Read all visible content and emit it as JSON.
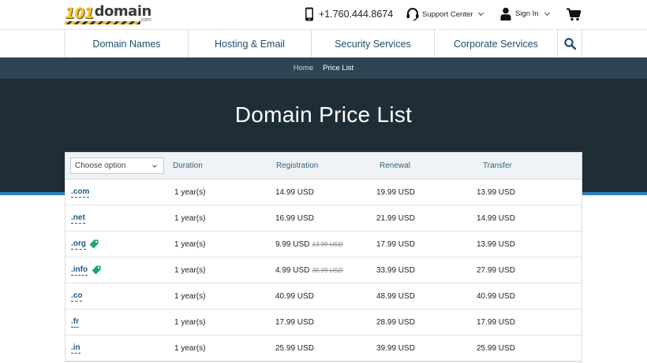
{
  "brand": {
    "logo_number": "101",
    "logo_word": "domain",
    "logo_suffix": ".com"
  },
  "header": {
    "phone": "+1.760.444.8674",
    "support_label": "Support Center",
    "signin_label": "Sign In"
  },
  "nav": {
    "items": [
      "Domain Names",
      "Hosting & Email",
      "Security Services",
      "Corporate Services"
    ]
  },
  "breadcrumb": {
    "home": "Home",
    "current": "Price List"
  },
  "page": {
    "title": "Domain Price List"
  },
  "colors": {
    "accent": "#2f86bf",
    "hero_bg": "#1f2e36",
    "link": "#1f5a82",
    "tag_green": "#1fa37a"
  },
  "table": {
    "filter_value": "Choose option",
    "columns": [
      "Duration",
      "Registration",
      "Renewal",
      "Transfer"
    ],
    "rows": [
      {
        "tld": ".com",
        "duration": "1 year(s)",
        "registration": "14.99 USD",
        "old_price": "",
        "renewal": "19.99 USD",
        "transfer": "13.99 USD",
        "sale": false
      },
      {
        "tld": ".net",
        "duration": "1 year(s)",
        "registration": "16.99 USD",
        "old_price": "",
        "renewal": "21.99 USD",
        "transfer": "14.99 USD",
        "sale": false
      },
      {
        "tld": ".org",
        "duration": "1 year(s)",
        "registration": "9.99 USD",
        "old_price": "13.99 USD",
        "renewal": "17.99 USD",
        "transfer": "13.99 USD",
        "sale": true
      },
      {
        "tld": ".info",
        "duration": "1 year(s)",
        "registration": "4.99 USD",
        "old_price": "30.99 USD",
        "renewal": "33.99 USD",
        "transfer": "27.99 USD",
        "sale": true
      },
      {
        "tld": ".co",
        "duration": "1 year(s)",
        "registration": "40.99 USD",
        "old_price": "",
        "renewal": "48.99 USD",
        "transfer": "40.99 USD",
        "sale": false
      },
      {
        "tld": ".fr",
        "duration": "1 year(s)",
        "registration": "17.99 USD",
        "old_price": "",
        "renewal": "28.99 USD",
        "transfer": "17.99 USD",
        "sale": false
      },
      {
        "tld": ".in",
        "duration": "1 year(s)",
        "registration": "25.99 USD",
        "old_price": "",
        "renewal": "39.99 USD",
        "transfer": "25.99 USD",
        "sale": false
      }
    ]
  }
}
